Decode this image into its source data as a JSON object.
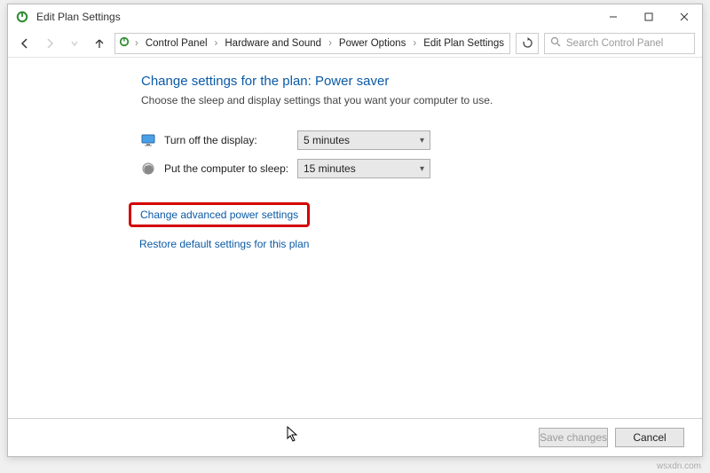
{
  "window": {
    "title": "Edit Plan Settings"
  },
  "breadcrumbs": {
    "items": [
      "Control Panel",
      "Hardware and Sound",
      "Power Options",
      "Edit Plan Settings"
    ]
  },
  "search": {
    "placeholder": "Search Control Panel"
  },
  "main": {
    "heading": "Change settings for the plan: Power saver",
    "description": "Choose the sleep and display settings that you want your computer to use.",
    "display_label": "Turn off the display:",
    "display_value": "5 minutes",
    "sleep_label": "Put the computer to sleep:",
    "sleep_value": "15 minutes",
    "advanced_link": "Change advanced power settings",
    "restore_link": "Restore default settings for this plan"
  },
  "footer": {
    "save": "Save changes",
    "cancel": "Cancel"
  },
  "watermark": "wsxdn.com"
}
